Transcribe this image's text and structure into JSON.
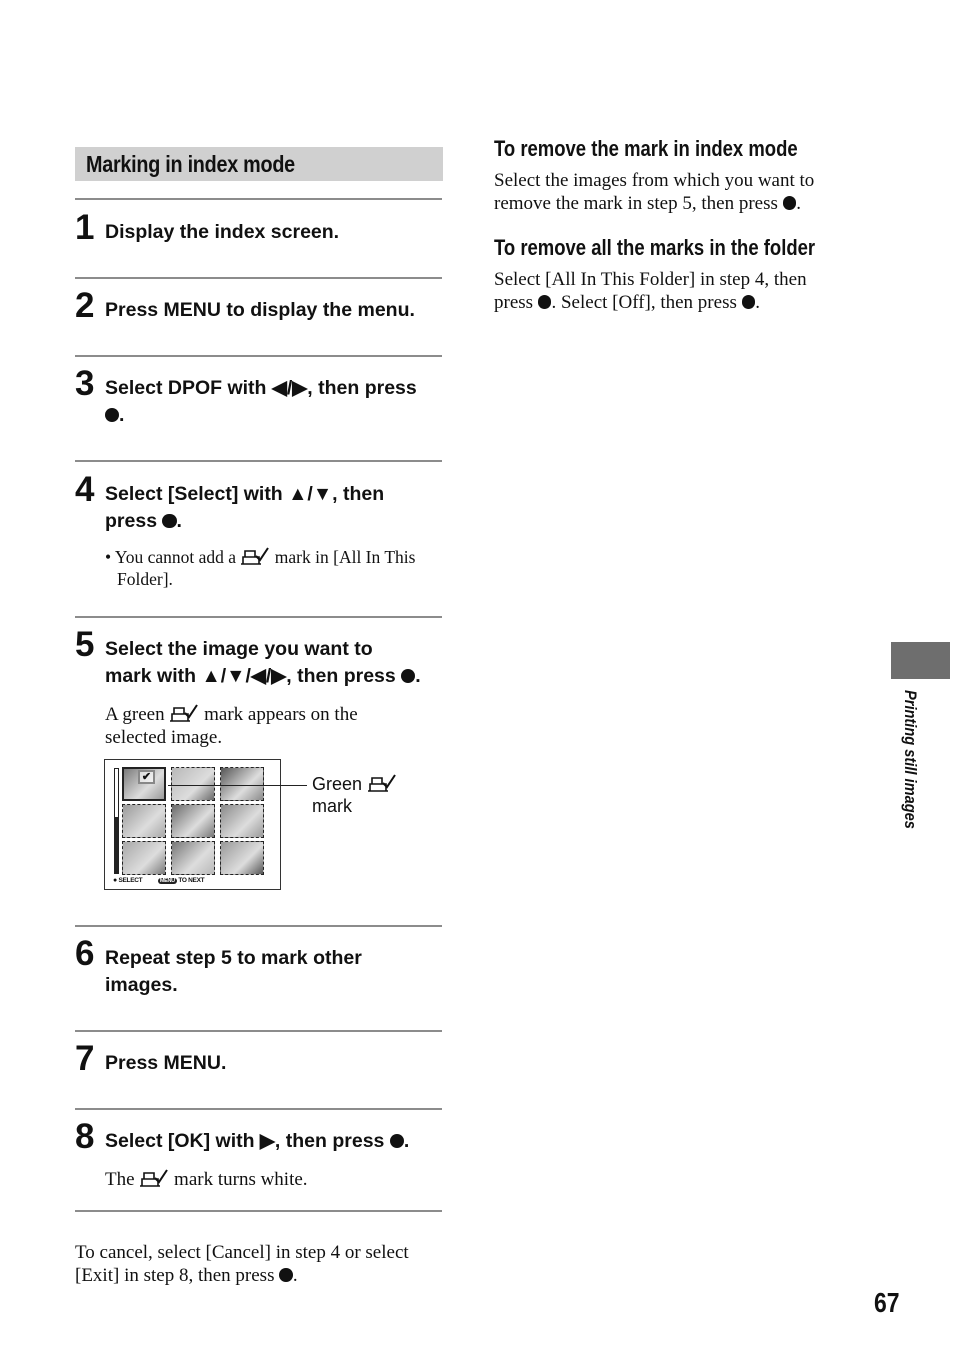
{
  "section": {
    "title": "Marking in index mode"
  },
  "steps": [
    {
      "num": "1",
      "text": "Display the index screen."
    },
    {
      "num": "2",
      "text": "Press MENU to display the menu."
    },
    {
      "num": "3",
      "text_a": "Select DPOF with ◀/▶, then press",
      "text_b": "."
    },
    {
      "num": "4",
      "text_a": "Select [Select] with ▲/▼, then",
      "text_b": "press",
      "text_c": ".",
      "note_a": "• You cannot add a",
      "note_b": "mark in [All In This",
      "note_c": "Folder]."
    },
    {
      "num": "5",
      "text_a": "Select the image you want to",
      "text_b": "mark with ▲/▼/◀/▶, then press",
      "text_c": ".",
      "body_a": "A green",
      "body_b": "mark appears on the",
      "body_c": "selected image."
    },
    {
      "num": "6",
      "text": "Repeat step 5 to mark other images."
    },
    {
      "num": "7",
      "text": "Press MENU."
    },
    {
      "num": "8",
      "text_a": "Select [OK] with ▶, then press",
      "text_b": ".",
      "body_a": "The",
      "body_b": "mark turns white."
    }
  ],
  "figure": {
    "callout_a": "Green",
    "callout_b": "mark",
    "footer_select": "SELECT",
    "footer_menu": "MENU",
    "footer_next": "TO NEXT",
    "scroll_position": 0.46,
    "selected_thumb": 0,
    "thumb_count": 9
  },
  "cancel_note": {
    "a": "To cancel, select [Cancel] in step 4 or select",
    "b": "[Exit] in step 8, then press",
    "c": "."
  },
  "right": {
    "h1": "To remove the mark in index mode",
    "p1_a": "Select the images from which you want to",
    "p1_b": "remove the mark in step 5, then press",
    "p1_c": ".",
    "h2": "To remove all the marks in the folder",
    "p2_a": "Select [All In This Folder] in step 4, then",
    "p2_b": "press",
    "p2_c": ". Select [Off], then press",
    "p2_d": "."
  },
  "side_tab": {
    "label": "Printing still images"
  },
  "page_number": "67"
}
